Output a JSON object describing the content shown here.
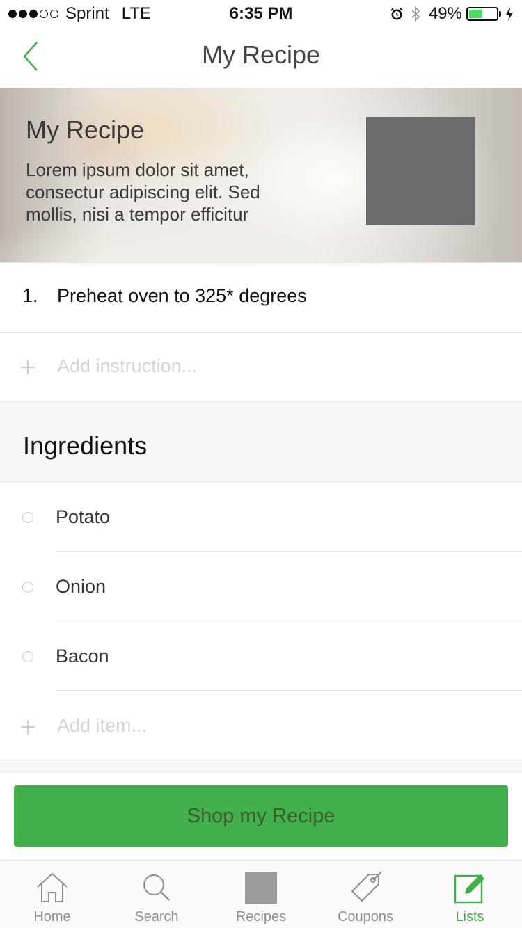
{
  "status_bar": {
    "carrier": "Sprint",
    "network": "LTE",
    "time": "6:35 PM",
    "battery_percent": "49%",
    "battery_level": 0.49
  },
  "nav": {
    "title": "My Recipe",
    "back_icon": "chevron-left-icon"
  },
  "hero": {
    "title": "My Recipe",
    "description": "Lorem ipsum dolor sit amet, consectur adipiscing elit. Sed mollis, nisi a tempor efficitur"
  },
  "instructions": {
    "steps": [
      {
        "number": "1.",
        "text": "Preheat oven to 325* degrees"
      }
    ],
    "add_placeholder": "Add instruction..."
  },
  "ingredients": {
    "title": "Ingredients",
    "items": [
      "Potato",
      "Onion",
      "Bacon"
    ],
    "add_placeholder": "Add item..."
  },
  "shop_button": {
    "label": "Shop my Recipe"
  },
  "tab_bar": {
    "tabs": [
      {
        "label": "Home",
        "icon": "home-icon"
      },
      {
        "label": "Search",
        "icon": "search-icon"
      },
      {
        "label": "Recipes",
        "icon": "recipes-icon"
      },
      {
        "label": "Coupons",
        "icon": "tag-icon"
      },
      {
        "label": "Lists",
        "icon": "edit-icon"
      }
    ],
    "active": "Lists"
  },
  "colors": {
    "accent": "#42b04a",
    "placeholder": "#d4d4d4",
    "section_bg": "#f6f7f7",
    "thumbnail": "#6b6b6b"
  }
}
